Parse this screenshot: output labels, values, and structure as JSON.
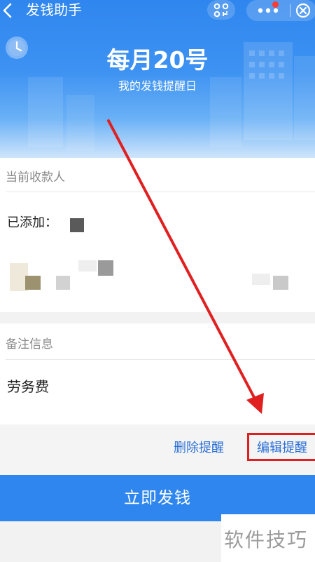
{
  "header": {
    "title": "发钱助手",
    "back_icon": "chevron-left-icon",
    "scan_icon": "mini-program-code-icon",
    "more_icon": "more-dots-icon",
    "close_icon": "close-circle-icon"
  },
  "hero": {
    "day": "每月20号",
    "subtitle": "我的发钱提醒日",
    "clock_icon": "clock-icon"
  },
  "payee": {
    "section_label": "当前收款人",
    "added_label": "已添加："
  },
  "note": {
    "section_label": "备注信息",
    "value": "劳务费"
  },
  "actions": {
    "delete_label": "删除提醒",
    "edit_label": "编辑提醒"
  },
  "primary_button": {
    "label": "立即发钱"
  },
  "watermark": "软件技巧",
  "colors": {
    "brand_blue": "#2e86ee",
    "link_blue": "#2b6fd6",
    "annotation_red": "#e02020"
  }
}
